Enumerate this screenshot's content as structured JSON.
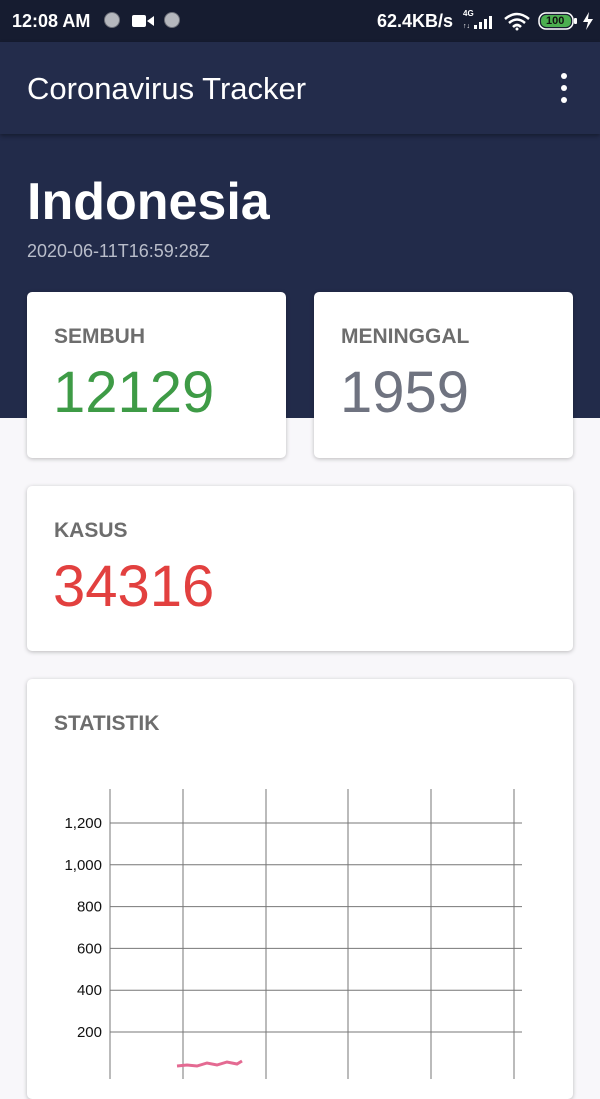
{
  "status_bar": {
    "time": "12:08 AM",
    "network_speed": "62.4KB/s",
    "network_type": "4G",
    "battery": "100"
  },
  "toolbar": {
    "title": "Coronavirus Tracker",
    "menu_icon": "more-vert-icon"
  },
  "summary": {
    "country": "Indonesia",
    "updated_at": "2020-06-11T16:59:28Z"
  },
  "cards": {
    "recovered": {
      "label": "SEMBUH",
      "value": "12129",
      "color": "#3e9b46"
    },
    "deaths": {
      "label": "MENINGGAL",
      "value": "1959",
      "color": "#6f7380"
    },
    "cases": {
      "label": "KASUS",
      "value": "34316",
      "color": "#e2403f"
    }
  },
  "statistics": {
    "label": "STATISTIK",
    "chart_data": {
      "type": "line",
      "y_ticks": [
        "1,200",
        "1,000",
        "800",
        "600",
        "400",
        "200"
      ],
      "ylim": [
        0,
        1300
      ],
      "grid": true,
      "series_color": "#e46a92"
    }
  },
  "colors": {
    "header_bg": "#222b4a",
    "statusbar_bg": "#161c30",
    "page_bg": "#f8f7fa"
  }
}
